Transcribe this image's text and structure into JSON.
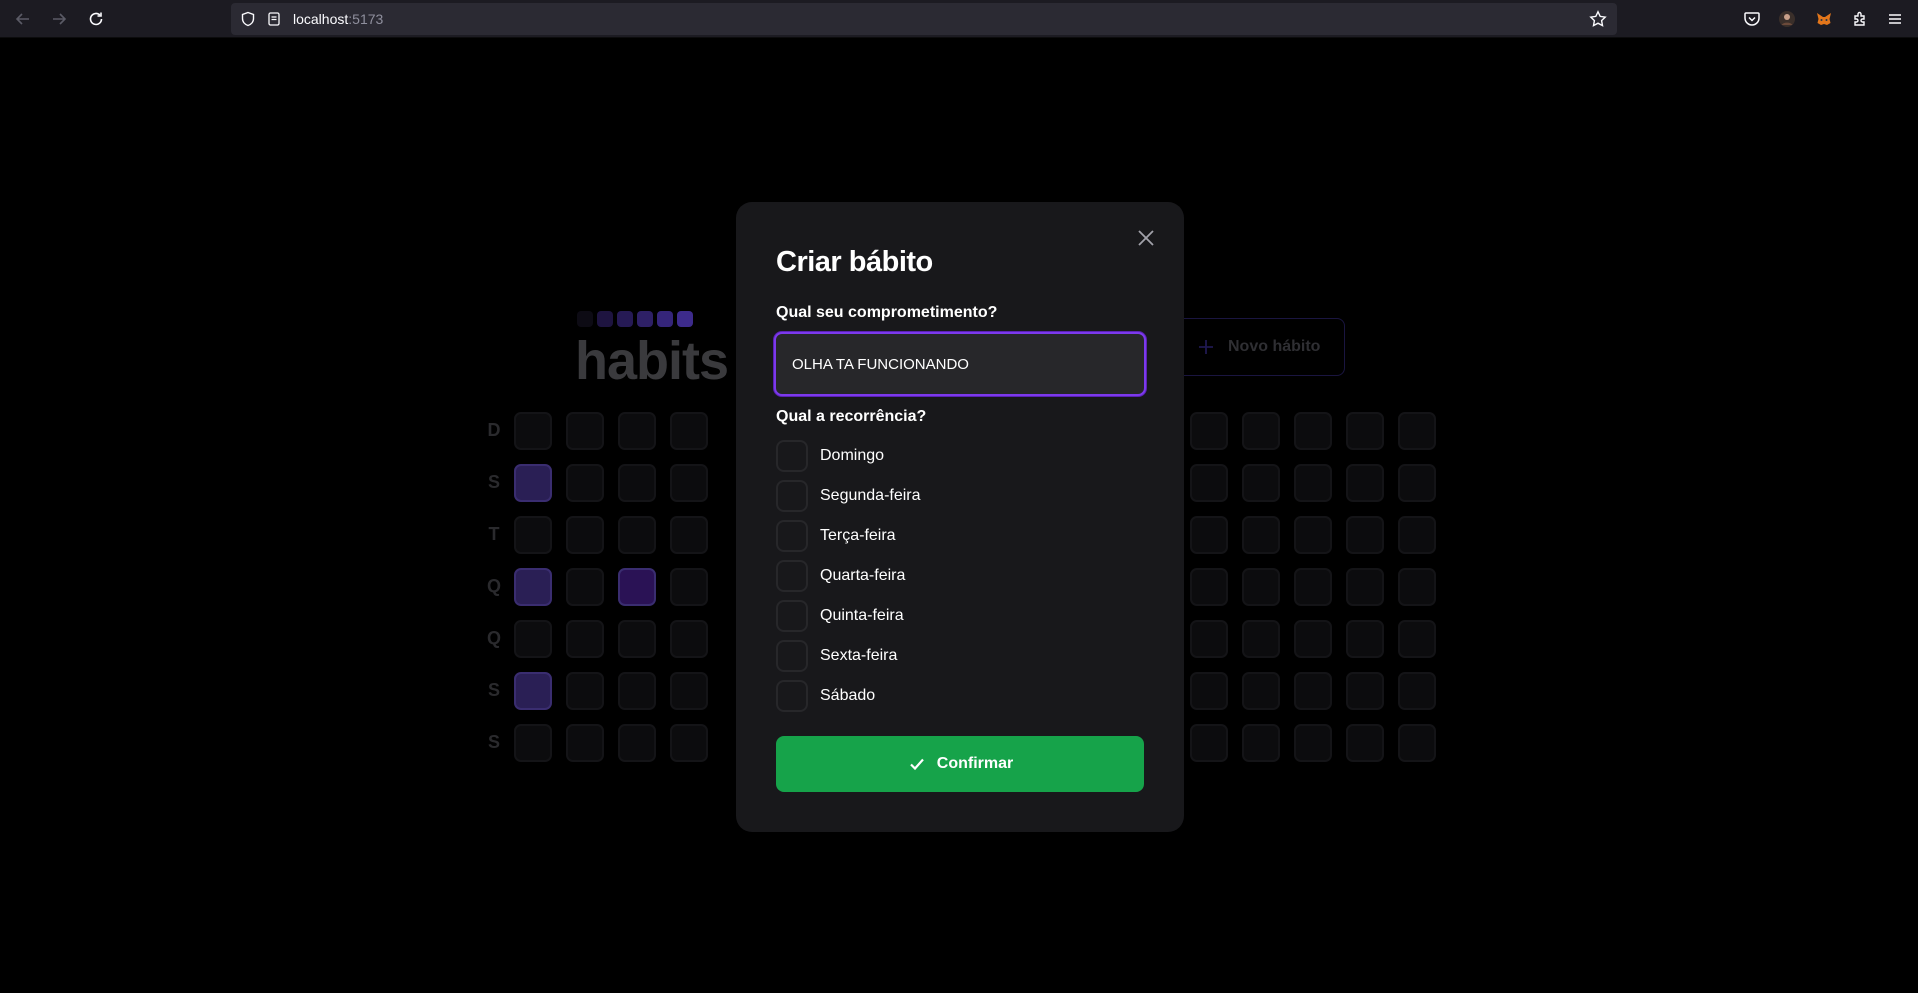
{
  "browser": {
    "url_host": "localhost",
    "url_port": ":5173",
    "icons": [
      "back-icon",
      "forward-icon",
      "reload-icon",
      "shield-icon",
      "page-icon",
      "bookmark-star-icon",
      "pocket-icon",
      "profile-icon",
      "metamask-icon",
      "extensions-icon",
      "menu-icon"
    ]
  },
  "app": {
    "logo": "habits",
    "new_habit_label": "Novo hábito",
    "weekdays": [
      "D",
      "S",
      "T",
      "Q",
      "Q",
      "S",
      "S"
    ],
    "accent_color": "#7c3aed"
  },
  "modal": {
    "title": "Criar bábito",
    "commitment_label": "Qual seu comprometimento?",
    "commitment_value": "OLHA TA FUNCIONANDO",
    "recurrence_label": "Qual a recorrência?",
    "days": [
      {
        "label": "Domingo",
        "checked": false
      },
      {
        "label": "Segunda-feira",
        "checked": false
      },
      {
        "label": "Terça-feira",
        "checked": false
      },
      {
        "label": "Quarta-feira",
        "checked": false
      },
      {
        "label": "Quinta-feira",
        "checked": false
      },
      {
        "label": "Sexta-feira",
        "checked": false
      },
      {
        "label": "Sábado",
        "checked": false
      }
    ],
    "confirm_label": "Confirmar",
    "confirm_color": "#16a34a"
  }
}
